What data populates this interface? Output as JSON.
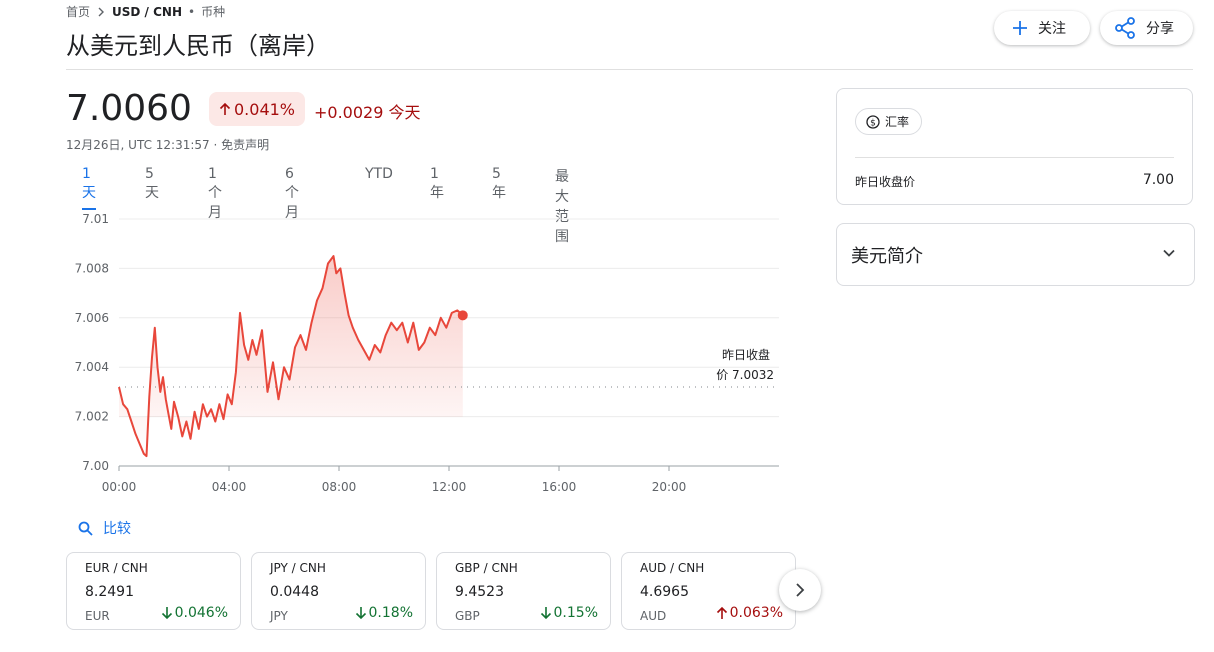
{
  "breadcrumb": {
    "home": "首页",
    "current": "USD / CNH",
    "sep": "•",
    "type": "币种"
  },
  "title": "从美元到人民币（离岸）",
  "header_buttons": {
    "follow": "关注",
    "share": "分享"
  },
  "quote": {
    "price": "7.0060",
    "change_pct": "0.041%",
    "change_abs": "+0.0029 今天",
    "timestamp": "12月26日, UTC 12:31:57 · 免责声明"
  },
  "range_tabs": [
    "1天",
    "5 天",
    "1 个月",
    "6 个月",
    "YTD",
    "1 年",
    "5 年",
    "最大范围"
  ],
  "active_range": "1天",
  "compare_label": "比较",
  "colors": {
    "up": "#a50e0e",
    "down": "#137333",
    "line": "#e8473b",
    "accent": "#1a73e8"
  },
  "chart_data": {
    "type": "line",
    "title": "",
    "xlabel": "",
    "ylabel": "",
    "x_ticks": [
      "00:00",
      "04:00",
      "08:00",
      "12:00",
      "16:00",
      "20:00"
    ],
    "x_range_hours": [
      0,
      24
    ],
    "y_ticks": [
      "7.00",
      "7.002",
      "7.004",
      "7.006",
      "7.008",
      "7.01"
    ],
    "ylim": [
      7.0,
      7.01
    ],
    "grid": true,
    "previous_close": 7.0032,
    "previous_close_label": "昨日收盘价 7.0032",
    "series": [
      {
        "x": [
          0,
          0.15,
          0.3,
          0.45,
          0.6,
          0.75,
          0.9,
          1.0,
          1.1,
          1.2,
          1.3,
          1.4,
          1.5,
          1.6,
          1.7,
          1.8,
          1.9,
          2.0,
          2.15,
          2.3,
          2.45,
          2.6,
          2.75,
          2.9,
          3.05,
          3.2,
          3.35,
          3.5,
          3.65,
          3.8,
          3.95,
          4.1,
          4.25,
          4.4,
          4.55,
          4.7,
          4.85,
          5.0,
          5.2,
          5.4,
          5.6,
          5.8,
          6.0,
          6.2,
          6.4,
          6.6,
          6.8,
          7.0,
          7.2,
          7.4,
          7.6,
          7.8,
          7.9,
          8.05,
          8.2,
          8.35,
          8.5,
          8.7,
          8.9,
          9.1,
          9.3,
          9.5,
          9.7,
          9.9,
          10.1,
          10.3,
          10.5,
          10.7,
          10.9,
          11.1,
          11.3,
          11.5,
          11.7,
          11.9,
          12.1,
          12.3,
          12.5
        ],
        "y": [
          7.0032,
          7.0025,
          7.0023,
          7.0018,
          7.0013,
          7.0009,
          7.0005,
          7.0004,
          7.0028,
          7.0044,
          7.0056,
          7.004,
          7.003,
          7.0036,
          7.0027,
          7.0021,
          7.0015,
          7.0026,
          7.002,
          7.0012,
          7.0018,
          7.0011,
          7.0022,
          7.0015,
          7.0025,
          7.002,
          7.0023,
          7.0018,
          7.0025,
          7.0019,
          7.0029,
          7.0025,
          7.0038,
          7.0062,
          7.0049,
          7.0043,
          7.0051,
          7.0045,
          7.0055,
          7.003,
          7.0042,
          7.0027,
          7.004,
          7.0035,
          7.0048,
          7.0053,
          7.0047,
          7.0058,
          7.0067,
          7.0072,
          7.0082,
          7.0085,
          7.0078,
          7.008,
          7.007,
          7.0061,
          7.0056,
          7.0051,
          7.0047,
          7.0043,
          7.0049,
          7.0046,
          7.0053,
          7.0058,
          7.0055,
          7.0058,
          7.005,
          7.0058,
          7.0047,
          7.005,
          7.0056,
          7.0053,
          7.006,
          7.0056,
          7.0062,
          7.0063,
          7.0061
        ]
      }
    ]
  },
  "currency_cards": [
    {
      "pair": "EUR / CNH",
      "value": "8.2491",
      "currency": "EUR",
      "change": "0.046%",
      "direction": "down"
    },
    {
      "pair": "JPY / CNH",
      "value": "0.0448",
      "currency": "JPY",
      "change": "0.18%",
      "direction": "down"
    },
    {
      "pair": "GBP / CNH",
      "value": "9.4523",
      "currency": "GBP",
      "change": "0.15%",
      "direction": "down"
    },
    {
      "pair": "AUD / CNH",
      "value": "4.6965",
      "currency": "AUD",
      "change": "0.063%",
      "direction": "up"
    }
  ],
  "sidebar": {
    "rate_chip": "汇率",
    "prev_close_label": "昨日收盘价",
    "prev_close_value": "7.00",
    "about_title": "美元简介"
  }
}
